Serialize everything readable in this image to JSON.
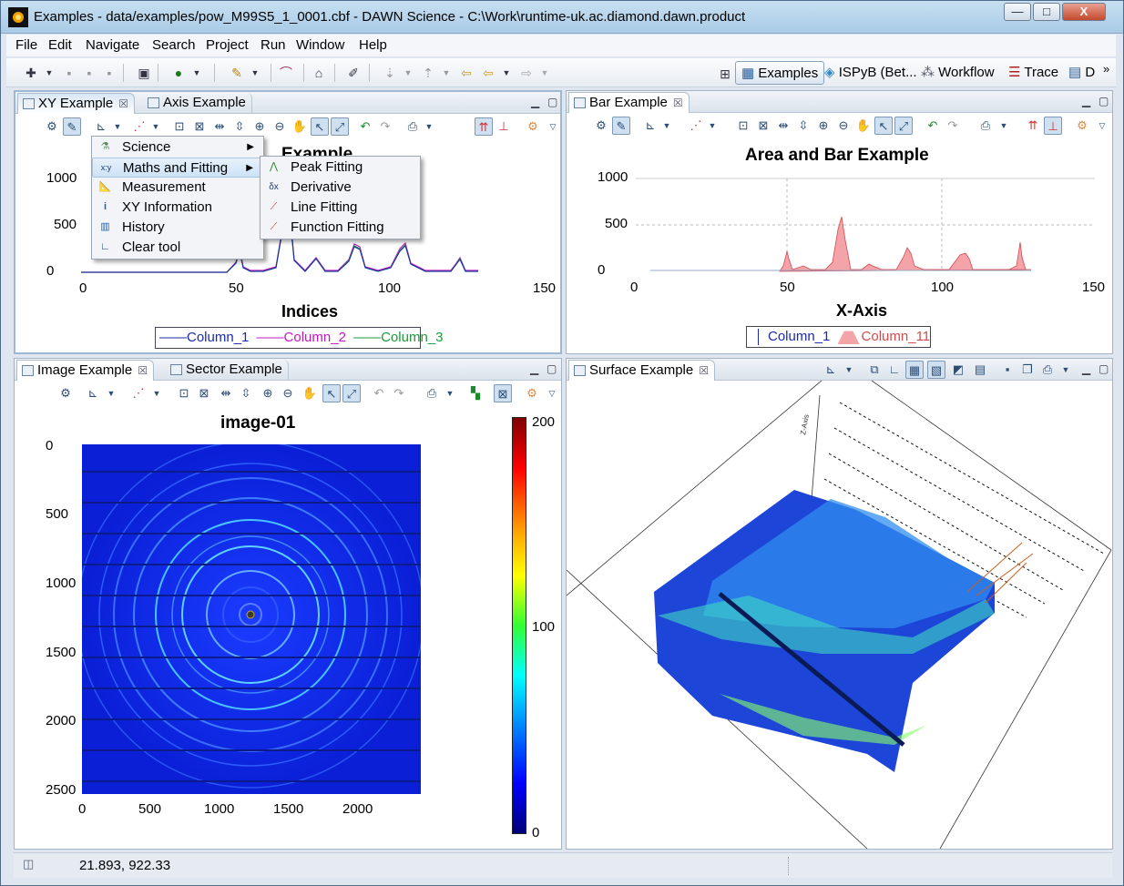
{
  "window": {
    "title": "Examples - data/examples/pow_M99S5_1_0001.cbf - DAWN Science - C:\\Work\\runtime-uk.ac.diamond.dawn.product",
    "btn_min": "—",
    "btn_max": "□",
    "btn_close": "X"
  },
  "menubar": [
    "File",
    "Edit",
    "Navigate",
    "Search",
    "Project",
    "Run",
    "Window",
    "Help"
  ],
  "perspectives": {
    "examples": "Examples",
    "ispyb": "ISPyB (Bet...",
    "workflow": "Workflow",
    "trace": "Trace",
    "d": "D",
    "more": "»"
  },
  "xy_view": {
    "tabs": [
      "XY Example",
      "Axis Example"
    ],
    "close": "☒",
    "title_partial": "Example",
    "xlabel": "Indices",
    "xticks": [
      "0",
      "50",
      "100",
      "150"
    ],
    "yticks": [
      "1000",
      "500",
      "0"
    ],
    "legend": [
      "Column_1",
      "Column_2",
      "Column_3"
    ]
  },
  "bar_view": {
    "tab": "Bar Example",
    "close": "☒",
    "title": "Area and Bar Example",
    "xlabel": "X-Axis",
    "xticks": [
      "0",
      "50",
      "100",
      "150"
    ],
    "yticks": [
      "1000",
      "500",
      "0"
    ],
    "legend": [
      "Column_1",
      "Column_11"
    ]
  },
  "image_view": {
    "tabs": [
      "Image Example",
      "Sector Example"
    ],
    "close": "☒",
    "title": "image-01",
    "xticks": [
      "0",
      "500",
      "1000",
      "1500",
      "2000"
    ],
    "yticks": [
      "0",
      "500",
      "1000",
      "1500",
      "2000",
      "2500"
    ],
    "colorbar": [
      "200",
      "100",
      "0"
    ]
  },
  "surface_view": {
    "tab": "Surface Example",
    "close": "☒",
    "zaxis": "Z-Axis"
  },
  "tool_menu": {
    "items": [
      {
        "label": "Science",
        "icon": "flask-icon",
        "submenu": true
      },
      {
        "label": "Maths and Fitting",
        "icon": "xy-math-icon",
        "submenu": true
      },
      {
        "label": "Measurement",
        "icon": "ruler-icon",
        "submenu": false
      },
      {
        "label": "XY Information",
        "icon": "info-icon",
        "submenu": false
      },
      {
        "label": "History",
        "icon": "history-chart-icon",
        "submenu": false
      },
      {
        "label": "Clear tool",
        "icon": "clear-tool-icon",
        "submenu": false
      }
    ],
    "submenu": [
      {
        "label": "Peak Fitting",
        "icon": "peak-fitting-icon"
      },
      {
        "label": "Derivative",
        "icon": "derivative-icon"
      },
      {
        "label": "Line Fitting",
        "icon": "line-fitting-icon"
      },
      {
        "label": "Function Fitting",
        "icon": "function-fitting-icon"
      }
    ],
    "arrow": "▶"
  },
  "statusbar": {
    "coords": "21.893, 922.33"
  },
  "colors": {
    "column1": "#1a2ab0",
    "column2": "#c018c0",
    "column3": "#1f9a3a",
    "column11": "#d44a4a",
    "bar_fill": "#f4a3a8"
  }
}
